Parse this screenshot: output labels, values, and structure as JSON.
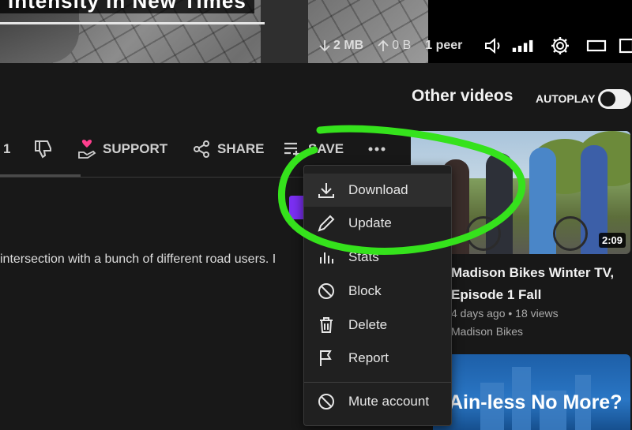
{
  "player": {
    "caption": "Intensity in New Times",
    "download_speed": "2 MB",
    "upload_speed": "0 B",
    "peers": "1 peer"
  },
  "sidebar": {
    "title": "Other videos",
    "autoplay_label": "AUTOPLAY",
    "autoplay_on": false
  },
  "actions": {
    "like_count": "1",
    "support": "SUPPORT",
    "share": "SHARE",
    "save": "SAVE"
  },
  "description": {
    "text": "intersection with a bunch of different road users. I"
  },
  "menu": {
    "items": [
      {
        "label": "Download",
        "icon": "download-icon"
      },
      {
        "label": "Update",
        "icon": "pencil-icon"
      },
      {
        "label": "Stats",
        "icon": "bar-chart-icon"
      },
      {
        "label": "Block",
        "icon": "block-icon"
      },
      {
        "label": "Delete",
        "icon": "trash-icon"
      },
      {
        "label": "Report",
        "icon": "flag-icon"
      },
      {
        "label": "Mute account",
        "icon": "mute-icon"
      }
    ]
  },
  "videos": [
    {
      "title": "Madison Bikes Winter TV, Episode 1 Fall",
      "meta": "4 days ago • 18 views",
      "channel": "Madison Bikes",
      "duration": "2:09"
    },
    {
      "thumb_text": "Ain-less No More?"
    }
  ],
  "colors": {
    "background": "#181818",
    "annotation": "#35e21c",
    "support_heart": "#ff3f8e",
    "accent_purple": "#7b2ff2"
  }
}
